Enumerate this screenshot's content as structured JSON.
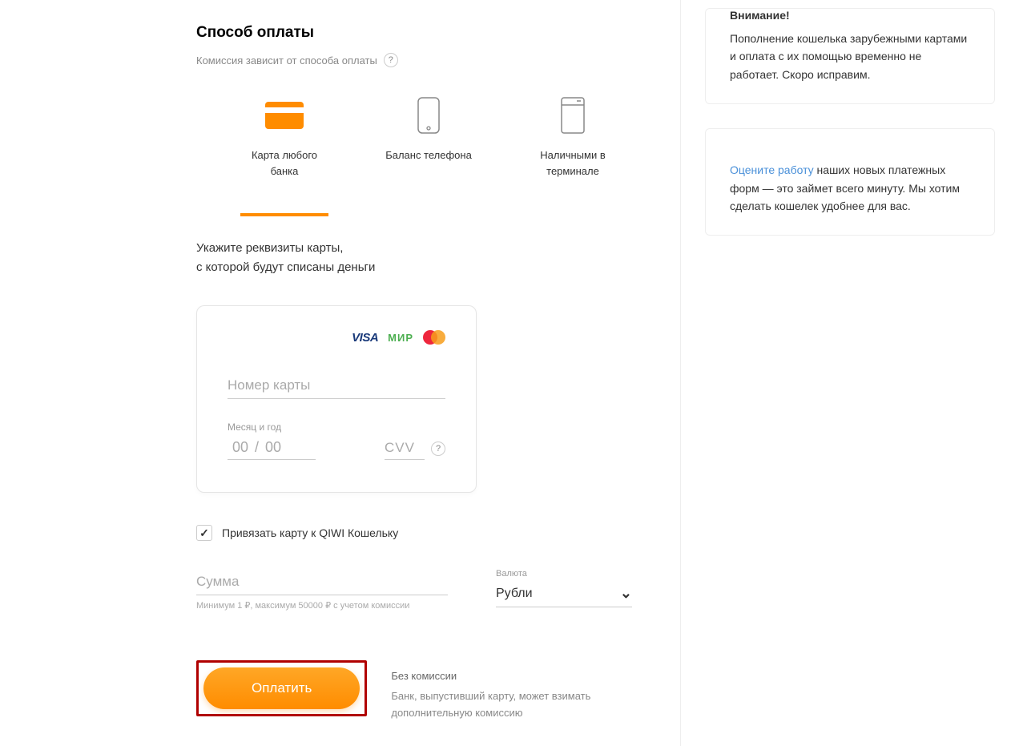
{
  "section": {
    "title": "Способ оплаты",
    "subtitle": "Комиссия зависит от способа оплаты",
    "help": "?"
  },
  "methods": {
    "card": "Карта любого банка",
    "phone": "Баланс телефона",
    "cash": "Наличными в терминале"
  },
  "card": {
    "instruction_line1": "Укажите реквизиты карты,",
    "instruction_line2": "с которой будут списаны деньги",
    "number_placeholder": "Номер карты",
    "expiry_label": "Месяц и год",
    "expiry_month_placeholder": "00",
    "expiry_year_placeholder": "00",
    "expiry_sep": "/",
    "cvv_placeholder": "CVV",
    "cvv_help": "?"
  },
  "logos": {
    "visa": "VISA",
    "mir": "МИР"
  },
  "bind": {
    "check": "✓",
    "label": "Привязать карту к QIWI Кошельку"
  },
  "amount": {
    "placeholder": "Сумма",
    "hint": "Минимум 1 ₽, максимум 50000 ₽ с учетом комиссии"
  },
  "currency": {
    "label": "Валюта",
    "value": "Рубли"
  },
  "submit": {
    "button": "Оплатить",
    "fee_title": "Без комиссии",
    "fee_note": "Банк, выпустивший карту, может взимать дополнительную комиссию"
  },
  "sidebar": {
    "notice_title": "Внимание!",
    "notice_text": "Пополнение кошелька зарубежными картами и оплата с их помощью временно не работает. Скоро исправим.",
    "feedback_link": "Оцените работу",
    "feedback_text": " наших новых платежных форм — это займет всего минуту. Мы хотим сделать кошелек удобнее для вас."
  }
}
